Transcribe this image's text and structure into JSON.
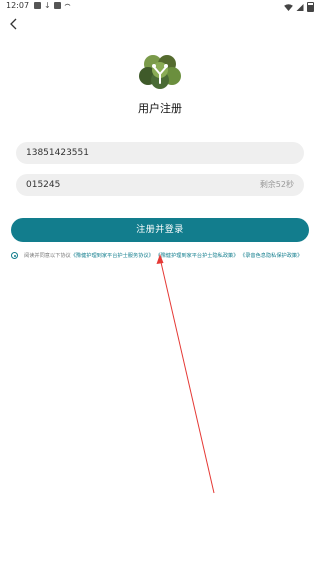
{
  "status_bar": {
    "time": "12:07"
  },
  "page": {
    "title": "用户注册"
  },
  "form": {
    "phone_value": "13851423551",
    "code_value": "015245",
    "countdown": "剩余52秒",
    "submit_label": "注册并登录"
  },
  "agreement": {
    "prefix": "阅读并同意以下协议",
    "links": [
      "《豫健护理到家平台护士服务协议》",
      "《豫健护理到家平台护士隐私政策》",
      "《录音色息隐私保护政策》"
    ]
  },
  "colors": {
    "accent": "#127d8d",
    "annotation": "#e53935"
  }
}
